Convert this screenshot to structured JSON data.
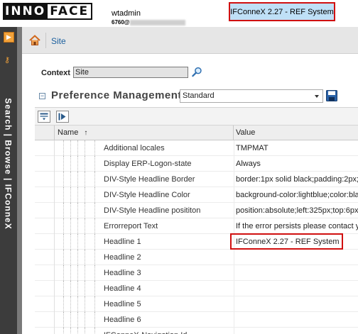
{
  "header": {
    "logo_left": "INNO",
    "logo_right": "FACE",
    "username": "wtadmin",
    "user_sub_prefix": "6760@",
    "system_label": "IFConneX 2.27 - REF System"
  },
  "sidebar": {
    "vertical_label": "Search | Browse | IFConneX",
    "icons": [
      "expand-panel-icon",
      "key-icon"
    ]
  },
  "breadcrumb": {
    "home_icon": "home-icon",
    "current": "Site"
  },
  "context": {
    "label": "Context",
    "value": "Site",
    "search_icon": "magnifier-icon"
  },
  "preferences": {
    "title": "Preference Management",
    "selected_profile": "Standard",
    "save_icon": "floppy-disk-icon"
  },
  "table": {
    "columns": {
      "name": "Name",
      "sort_indicator": "↑",
      "value": "Value"
    },
    "rows": [
      {
        "name": "Additional locales",
        "value": "TMPMAT"
      },
      {
        "name": "Display ERP-Logon-state",
        "value": "Always"
      },
      {
        "name": "DIV-Style Headline Border",
        "value": "border:1px solid black;padding:2px;"
      },
      {
        "name": "DIV-Style Headline Color",
        "value": "background-color:lightblue;color:bla"
      },
      {
        "name": "DIV-Style Headline posititon",
        "value": "position:absolute;left:325px;top:6px"
      },
      {
        "name": "Errorreport Text",
        "value": "If the error persists please contact y"
      },
      {
        "name": "Headline 1",
        "value": "IFConneX 2.27 - REF System"
      },
      {
        "name": "Headline 2",
        "value": ""
      },
      {
        "name": "Headline 3",
        "value": ""
      },
      {
        "name": "Headline 4",
        "value": ""
      },
      {
        "name": "Headline 5",
        "value": ""
      },
      {
        "name": "Headline 6",
        "value": ""
      },
      {
        "name": "IFConneX-Navigation Id",
        "value": ""
      }
    ]
  },
  "colors": {
    "highlight_border": "#d01010",
    "system_badge_bg": "#bfe0f7",
    "sidebar_bg": "#3c3c3c",
    "accent_orange": "#f2a23a",
    "link_blue": "#1a5f9e"
  }
}
